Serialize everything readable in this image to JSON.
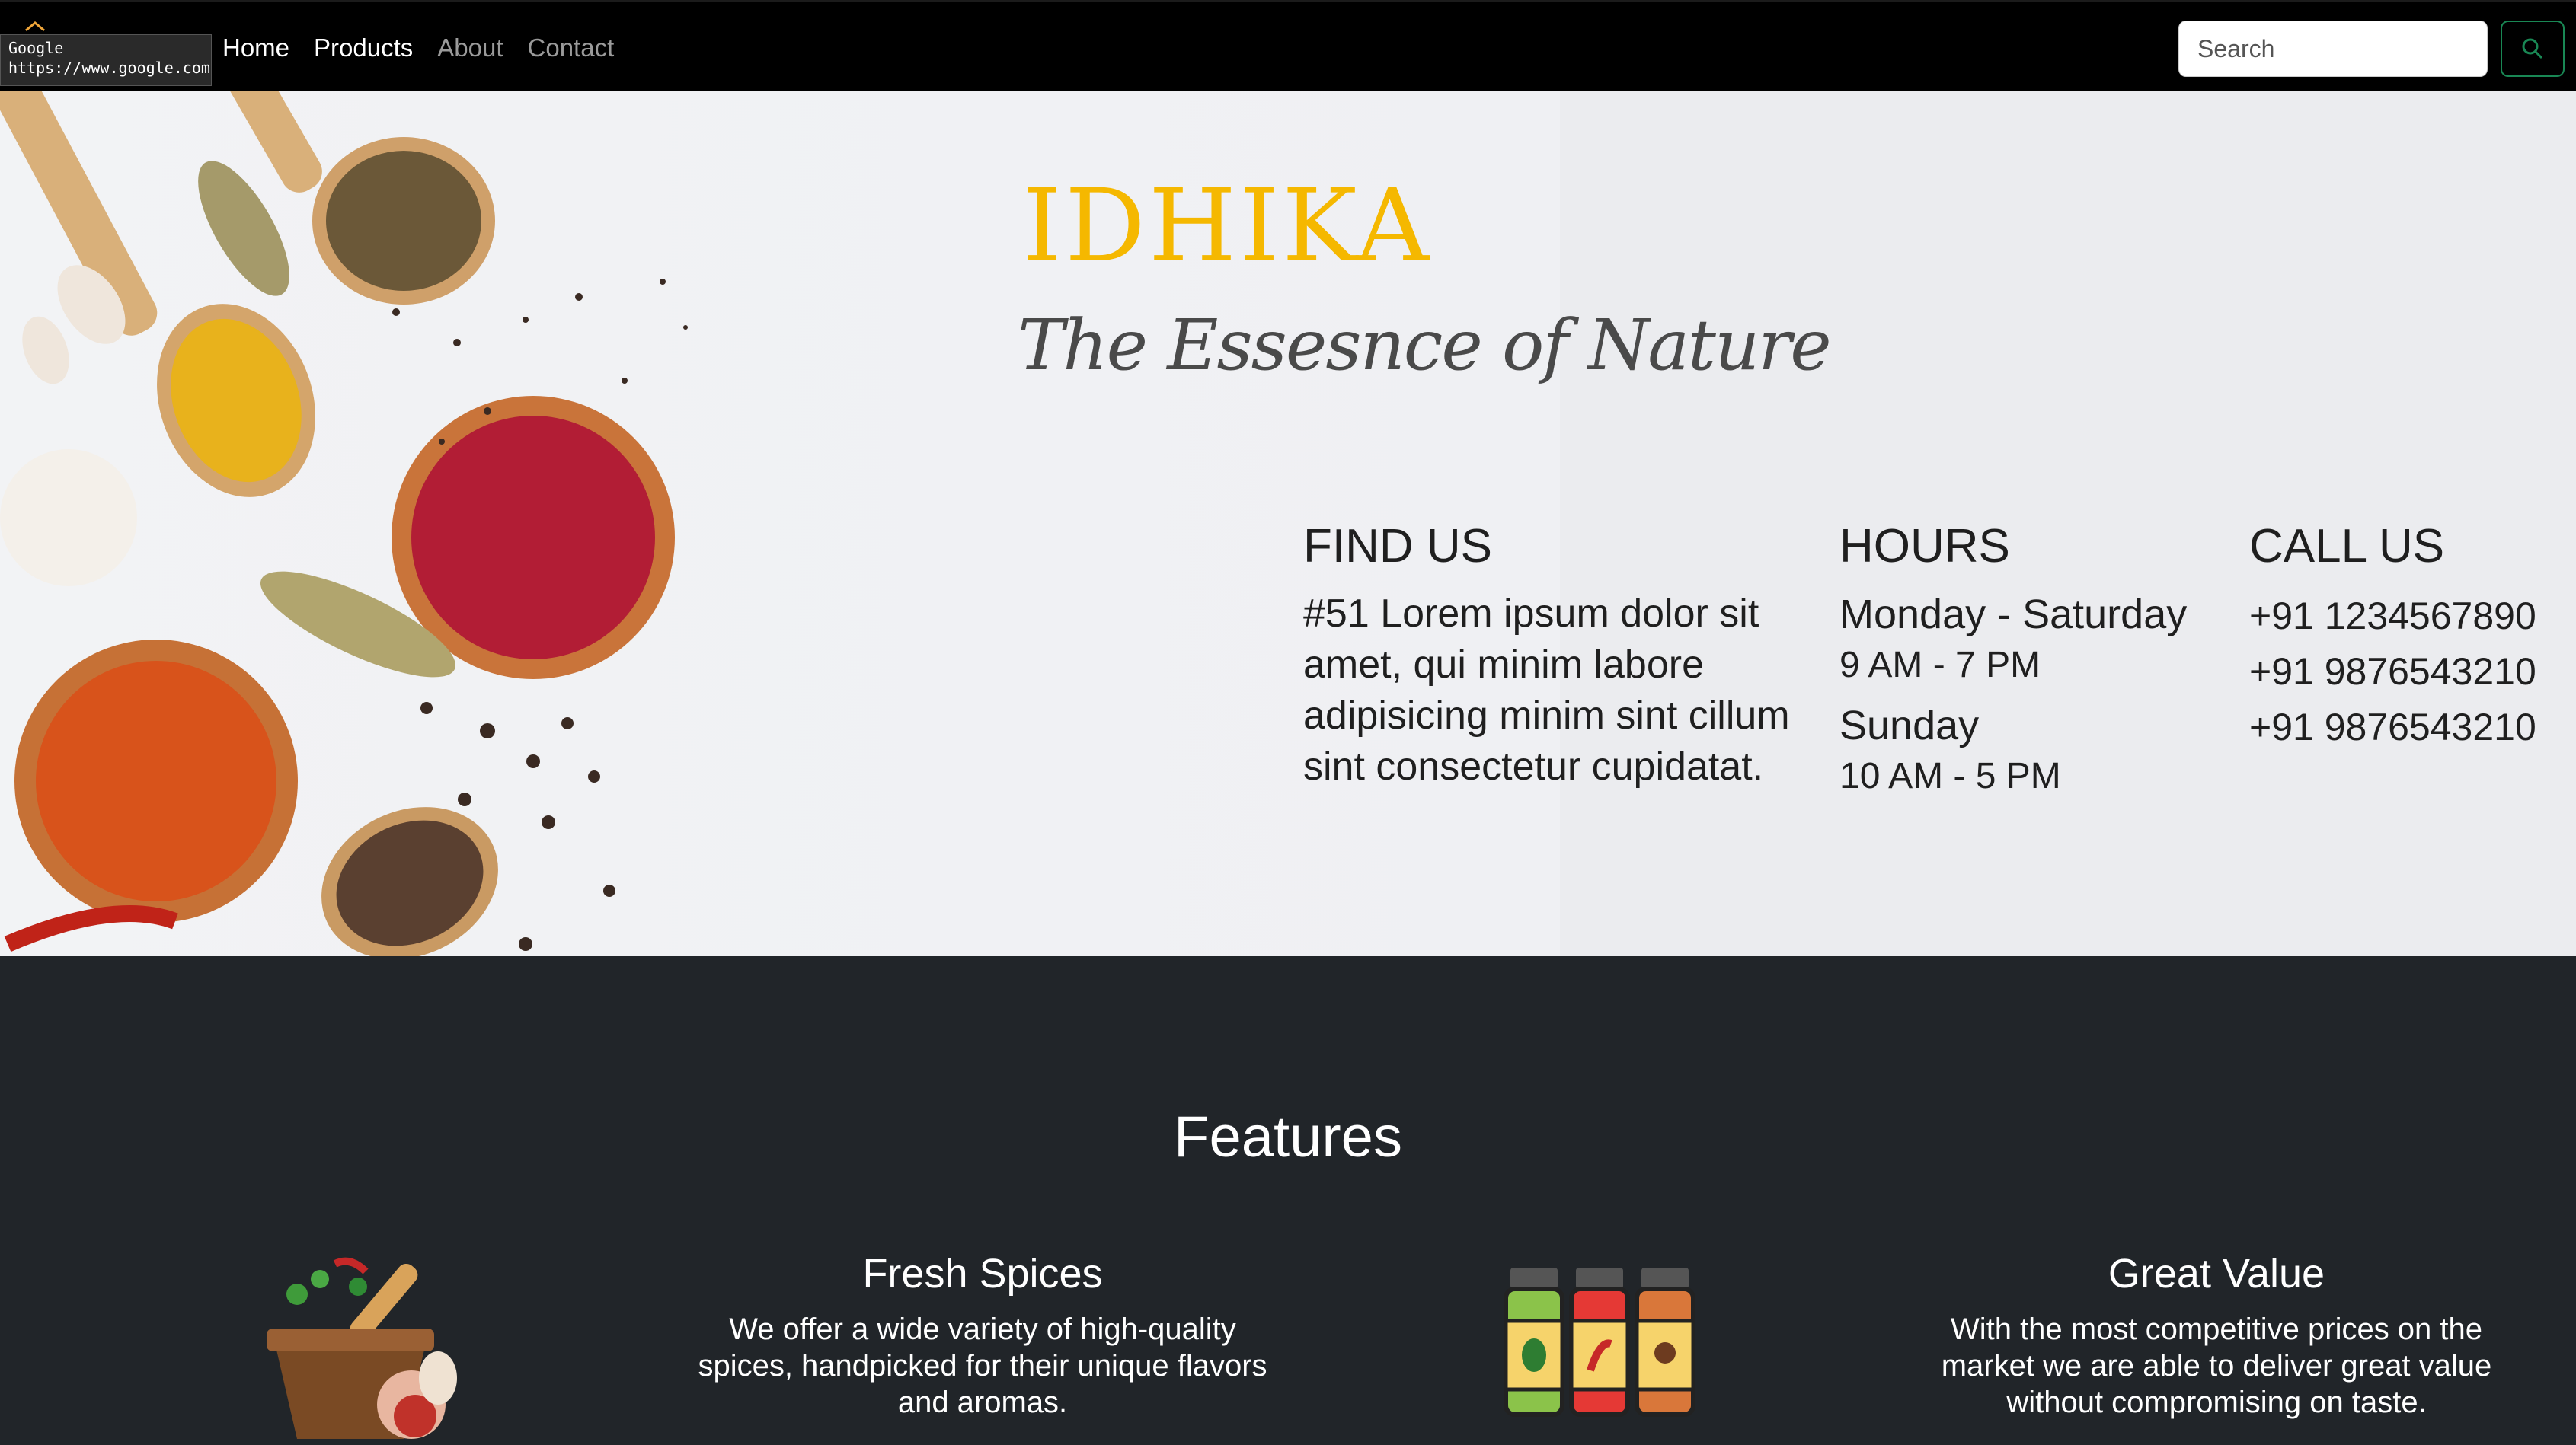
{
  "tooltip": {
    "title": "Google",
    "url": "https://www.google.com"
  },
  "nav": {
    "links": [
      {
        "label": "Home"
      },
      {
        "label": "Products"
      },
      {
        "label": "About"
      },
      {
        "label": "Contact"
      }
    ],
    "search": {
      "placeholder": "Search",
      "value": ""
    },
    "search_icon": "search-icon",
    "search_button_color": "#198754"
  },
  "hero": {
    "brand": "IDHIKA",
    "tagline": "The Essesnce of Nature",
    "find_us": {
      "heading": "FIND US",
      "address": "#51 Lorem ipsum dolor sit amet, qui minim labore adipisicing minim sint cillum sint consectetur cupidatat."
    },
    "hours": {
      "heading": "HOURS",
      "weekday_label": "Monday - Saturday",
      "weekday_time": "9 AM - 7 PM",
      "sunday_label": "Sunday",
      "sunday_time": "10 AM - 5 PM"
    },
    "call_us": {
      "heading": "CALL US",
      "phones": [
        "+91 1234567890",
        "+91 9876543210",
        "+91 9876543210"
      ]
    }
  },
  "features": {
    "title": "Features",
    "items": [
      {
        "icon": "mortar-pestle-icon",
        "heading": "Fresh Spices",
        "text": "We offer a wide variety of high-quality spices, handpicked for their unique flavors and aromas."
      },
      {
        "icon": "spice-jars-icon",
        "heading": "Great Value",
        "text": "With the most competitive prices on the market we are able to deliver great value without compromising on taste."
      }
    ]
  },
  "colors": {
    "brand": "#f5b800",
    "navbar": "#000000",
    "features_bg": "#212529"
  }
}
